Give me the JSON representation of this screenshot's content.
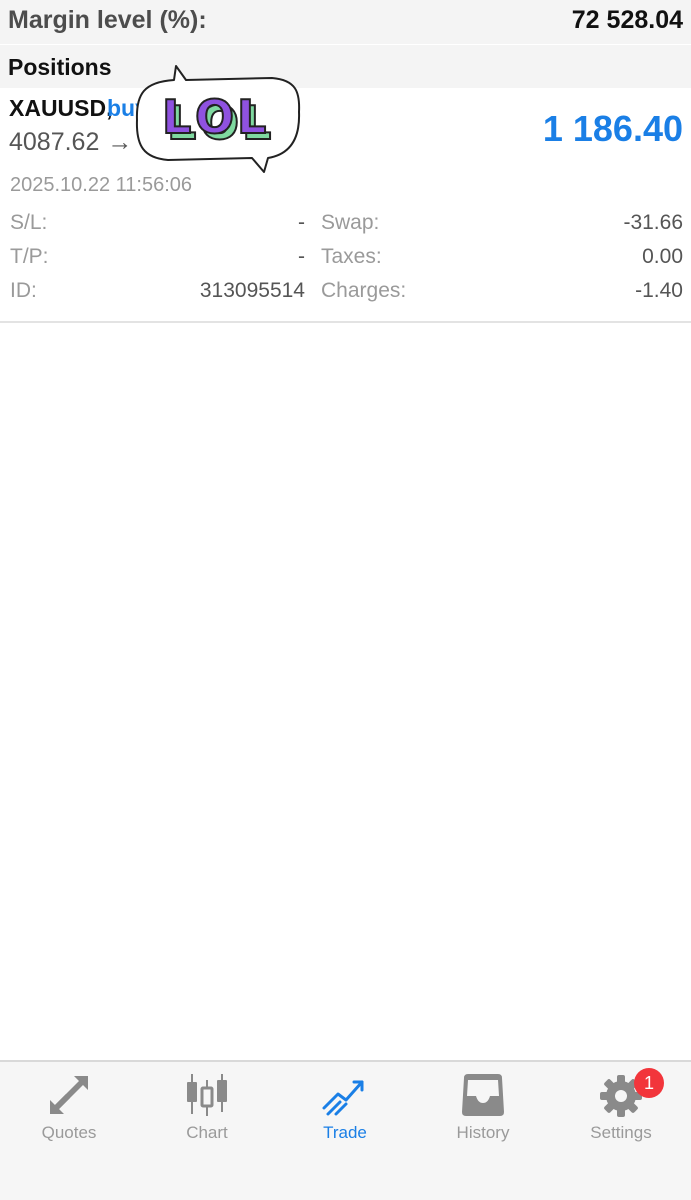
{
  "margin": {
    "label": "Margin level (%):",
    "value": "72 528.04"
  },
  "section": {
    "title": "Positions"
  },
  "position": {
    "symbol": "XAUUSD,",
    "direction": "buy",
    "open_price": "4087.62",
    "arrow": "→",
    "profit": "1 186.40",
    "timestamp": "2025.10.22 11:56:06",
    "sl_label": "S/L:",
    "sl_value": "-",
    "tp_label": "T/P:",
    "tp_value": "-",
    "id_label": "ID:",
    "id_value": "313095514",
    "swap_label": "Swap:",
    "swap_value": "-31.66",
    "taxes_label": "Taxes:",
    "taxes_value": "0.00",
    "charges_label": "Charges:",
    "charges_value": "-1.40"
  },
  "sticker": {
    "text": "LOL",
    "icon": "speech-bubble-sticker"
  },
  "tabs": [
    {
      "label": "Quotes",
      "icon": "quotes-arrows-icon",
      "active": false
    },
    {
      "label": "Chart",
      "icon": "candlestick-icon",
      "active": false
    },
    {
      "label": "Trade",
      "icon": "trade-trend-icon",
      "active": true
    },
    {
      "label": "History",
      "icon": "inbox-tray-icon",
      "active": false
    },
    {
      "label": "Settings",
      "icon": "gear-icon",
      "active": false,
      "badge": "1"
    }
  ],
  "colors": {
    "accent": "#1a7fe6",
    "badge": "#f2353b",
    "sticker_letters": "#8f52e0",
    "sticker_shadow": "#7fd9a0"
  }
}
